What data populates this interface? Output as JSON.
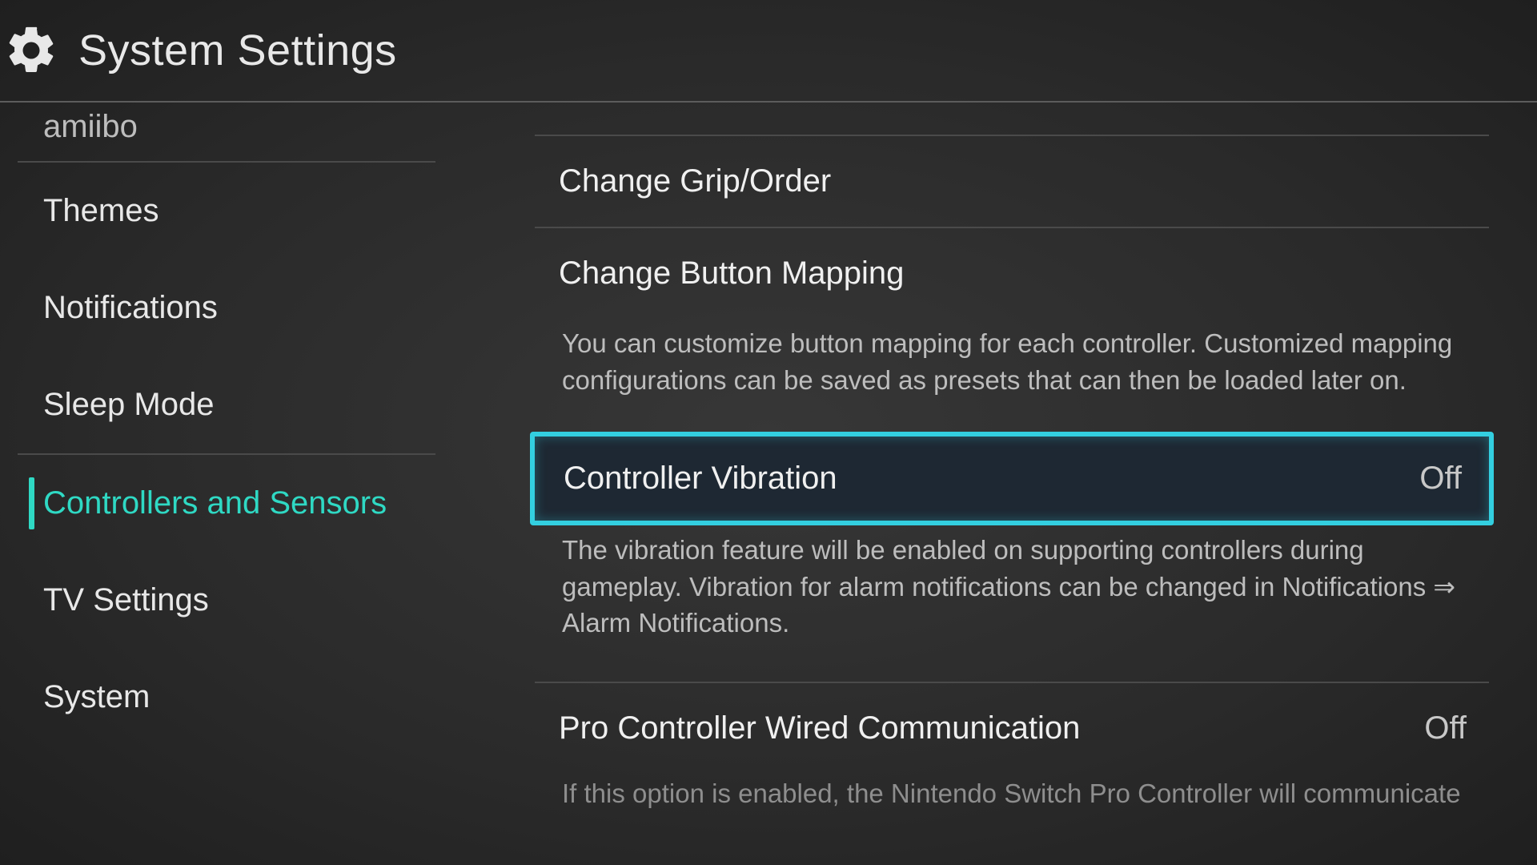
{
  "header": {
    "title": "System Settings"
  },
  "sidebar": {
    "items": [
      {
        "label": "amiibo",
        "partial": true
      },
      {
        "label": "Themes"
      },
      {
        "label": "Notifications"
      },
      {
        "label": "Sleep Mode"
      },
      {
        "label": "Controllers and Sensors",
        "selected": true
      },
      {
        "label": "TV Settings"
      },
      {
        "label": "System"
      }
    ]
  },
  "main": {
    "change_grip_label": "Change Grip/Order",
    "change_button_mapping_label": "Change Button Mapping",
    "button_mapping_description": "You can customize button mapping for each controller. Customized mapping configurations can be saved as presets that can then be loaded later on.",
    "controller_vibration_label": "Controller Vibration",
    "controller_vibration_value": "Off",
    "controller_vibration_description": "The vibration feature will be enabled on supporting controllers during gameplay. Vibration for alarm notifications can be changed in Notifications ⇒ Alarm Notifications.",
    "pro_controller_label": "Pro Controller Wired Communication",
    "pro_controller_value": "Off",
    "pro_controller_description_partial": "If this option is enabled, the Nintendo Switch Pro Controller will communicate"
  }
}
